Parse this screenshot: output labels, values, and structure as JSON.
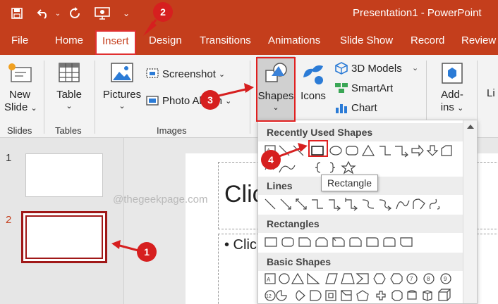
{
  "window": {
    "title": "Presentation1  -  PowerPoint"
  },
  "tabs": [
    "File",
    "Home",
    "Insert",
    "Design",
    "Transitions",
    "Animations",
    "Slide Show",
    "Record",
    "Review"
  ],
  "ribbon": {
    "new_slide": "New",
    "new_slide2": "Slide",
    "table": "Table",
    "pictures": "Pictures",
    "screenshot": "Screenshot",
    "photo_album": "Photo Album",
    "shapes": "Shapes",
    "icons": "Icons",
    "models": "3D Models",
    "smartart": "SmartArt",
    "chart": "Chart",
    "addins": "Add-",
    "addins2": "ins",
    "links_partial": "Li",
    "groups": {
      "slides": "Slides",
      "tables": "Tables",
      "images": "Images"
    }
  },
  "thumbnails": {
    "numbers": [
      "1",
      "2"
    ]
  },
  "slide": {
    "title_partial": "Clic",
    "bullet_partial": "• Clic"
  },
  "dropdown": {
    "sections": [
      "Recently Used Shapes",
      "Lines",
      "Rectangles",
      "Basic Shapes"
    ]
  },
  "tooltip": "Rectangle",
  "watermark": "@thegeekpage.com",
  "callouts": [
    "1",
    "2",
    "3",
    "4"
  ],
  "colors": {
    "accent": "#c43e1c",
    "callout": "#d61f1f"
  }
}
